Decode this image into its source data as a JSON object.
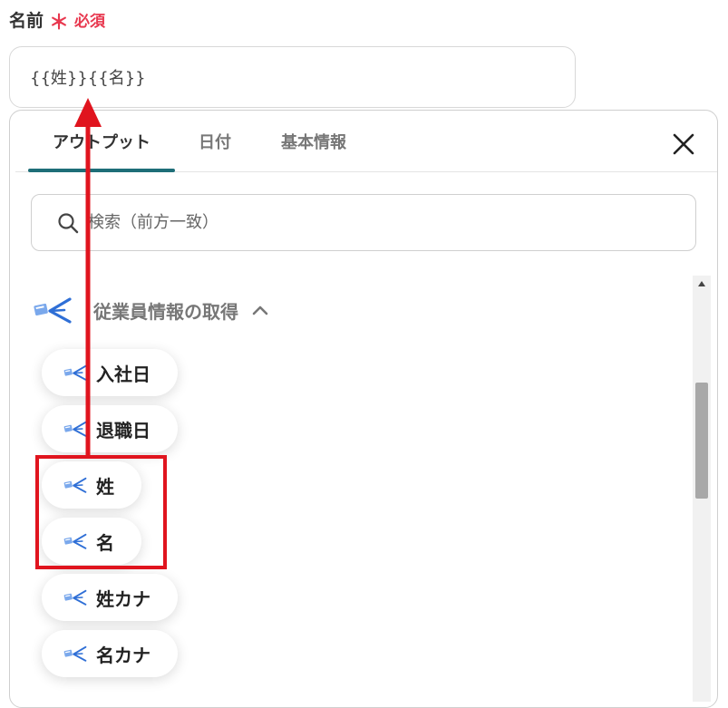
{
  "field": {
    "label": "名前",
    "required_mark": "＊",
    "required_text": "必須",
    "value": "{{姓}}{{名}}"
  },
  "tabs": [
    {
      "label": "アウトプット",
      "active": true
    },
    {
      "label": "日付",
      "active": false
    },
    {
      "label": "基本情報",
      "active": false
    }
  ],
  "search": {
    "placeholder": "検索（前方一致）"
  },
  "group": {
    "title": "従業員情報の取得",
    "icon": "app-arrow-icon"
  },
  "items": [
    {
      "label": "入社日"
    },
    {
      "label": "退職日"
    },
    {
      "label": "姓"
    },
    {
      "label": "名"
    },
    {
      "label": "姓カナ"
    },
    {
      "label": "名カナ"
    }
  ],
  "colors": {
    "accent": "#1e6e78",
    "required": "#e8384f",
    "annotation": "#e0141e",
    "icon_blue": "#2f6fd6"
  }
}
